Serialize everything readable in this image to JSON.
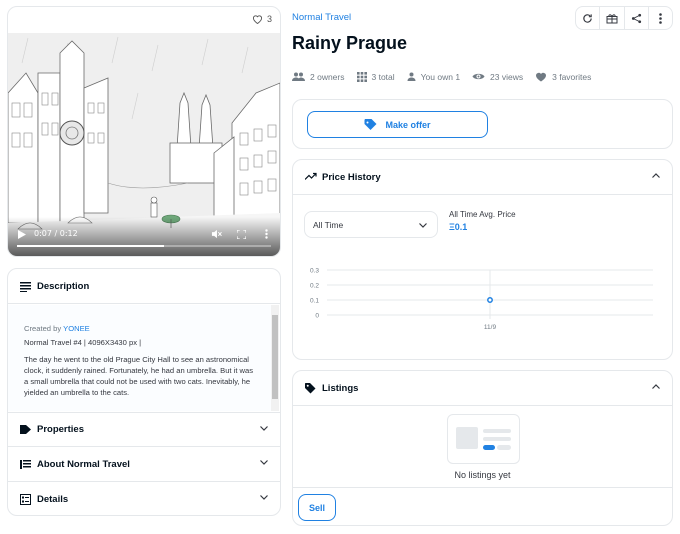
{
  "media": {
    "favorites_count": "3",
    "video": {
      "current_time": "0:07",
      "duration": "0:12",
      "time_display": "0:07 / 0:12",
      "progress": 0.58
    }
  },
  "description": {
    "heading": "Description",
    "created_by_label": "Created by",
    "creator": "YONEE",
    "meta": "Normal Travel #4 | 4096X3430 px |",
    "body": "The day he went to the old Prague City Hall to see an astronomical clock, it suddenly rained. Fortunately, he had an umbrella. But it was a small umbrella that could not be used with two cats. Inevitably, he yielded an umbrella to the cats."
  },
  "accordions": {
    "properties": "Properties",
    "about": "About Normal Travel",
    "details": "Details"
  },
  "item": {
    "collection": "Normal Travel",
    "title": "Rainy Prague"
  },
  "stats": {
    "owners": "2 owners",
    "total": "3 total",
    "you_own": "You own 1",
    "views": "23 views",
    "favorites": "3 favorites"
  },
  "offer": {
    "button_label": "Make offer"
  },
  "price_history": {
    "heading": "Price History",
    "period_select": "All Time",
    "avg_label": "All Time Avg. Price",
    "avg_value": "Ξ0.1"
  },
  "chart_data": {
    "type": "scatter",
    "title": "",
    "xlabel": "",
    "ylabel": "",
    "x": [
      "11/9"
    ],
    "y": [
      0.1
    ],
    "yticks": [
      0,
      0.1,
      0.2,
      0.3
    ],
    "ytick_labels": [
      "0",
      "0.1",
      "0.2",
      "0.3"
    ],
    "ylim": [
      0,
      0.3
    ],
    "point_color": "#2081e2"
  },
  "listings": {
    "heading": "Listings",
    "empty_text": "No listings yet",
    "sell_label": "Sell"
  },
  "colors": {
    "accent": "#2081e2",
    "text": "#04111d",
    "muted": "#707a83",
    "border": "#e5e8eb"
  }
}
